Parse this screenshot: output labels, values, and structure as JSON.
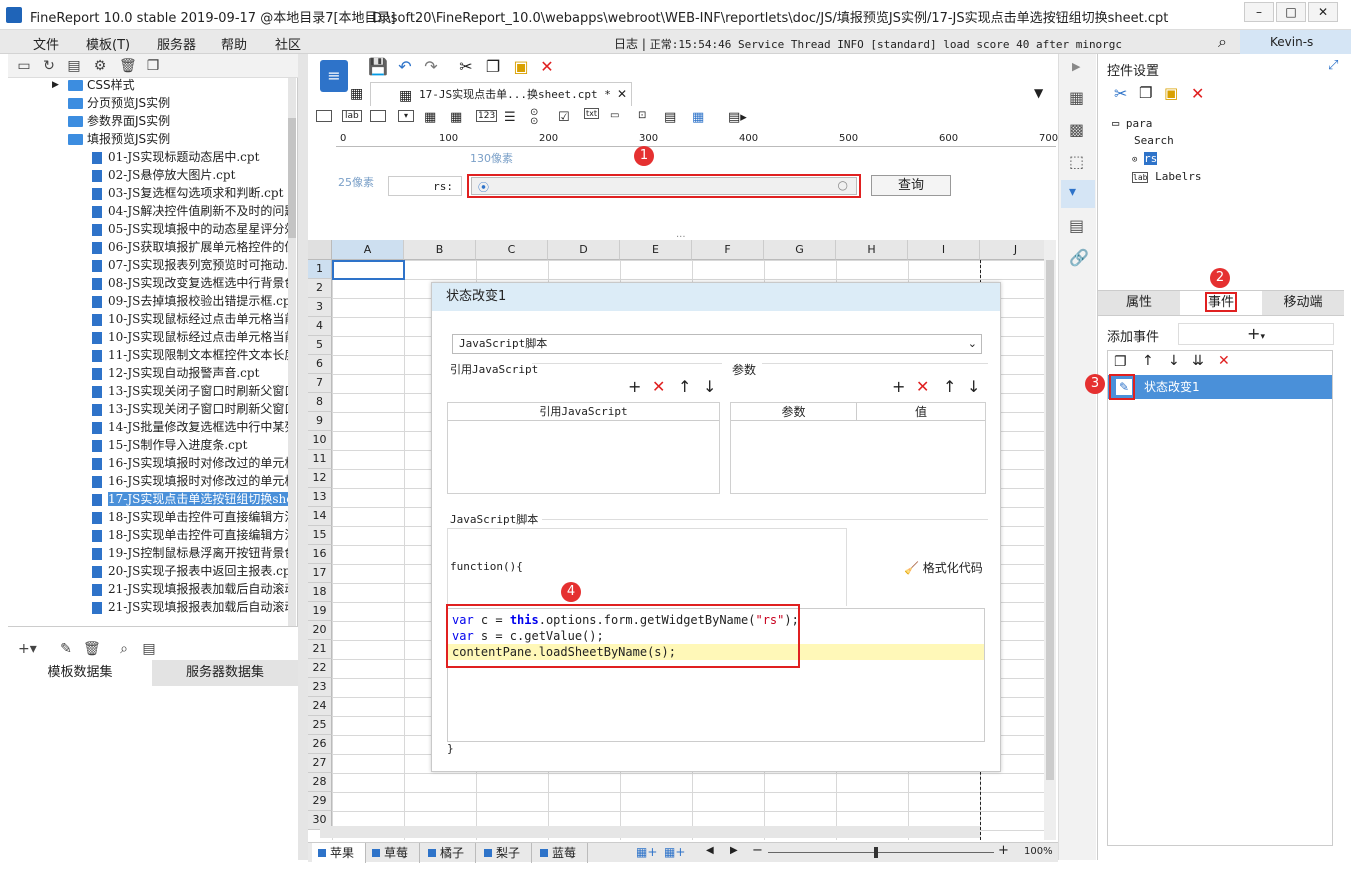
{
  "window": {
    "title": "FineReport 10.0 stable 2019-09-17 @本地目录7[本地目录]",
    "path": "D:\\soft20\\FineReport_10.0\\webapps\\webroot\\WEB-INF\\reportlets\\doc/JS/填报预览JS实例/17-JS实现点击单选按钮组切换sheet.cpt"
  },
  "menu": [
    "文件",
    "模板(T)",
    "服务器",
    "帮助",
    "社区"
  ],
  "log": {
    "label": "日志",
    "sep": "|",
    "text": "正常:15:54:46 Service Thread INFO [standard] load score 40 after minorgc"
  },
  "user": "Kevin-s",
  "tree": {
    "folders": [
      "CSS样式",
      "分页预览JS实例",
      "参数界面JS实例",
      "填报预览JS实例"
    ],
    "files": [
      "01-JS实现标题动态居中.cpt",
      "02-JS悬停放大图片.cpt",
      "03-JS复选框勾选项求和判断.cpt",
      "04-JS解决控件值刷新不及时的问题",
      "05-JS实现填报中的动态星星评分效",
      "06-JS获取填报扩展单元格控件的值",
      "07-JS实现报表列宽预览时可拖动.",
      "08-JS实现改变复选框选中行背景色",
      "09-JS去掉填报校验出错提示框.cp",
      "10-JS实现鼠标经过点击单元格当前",
      "10-JS实现鼠标经过点击单元格当前",
      "11-JS实现限制文本框控件文本长度",
      "12-JS实现自动报警声音.cpt",
      "13-JS实现关闭子窗口时刷新父窗口",
      "13-JS实现关闭子窗口时刷新父窗口",
      "14-JS批量修改复选框选中行中某列",
      "15-JS制作导入进度条.cpt",
      "16-JS实现填报时对修改过的单元格",
      "16-JS实现填报时对修改过的单元格",
      "17-JS实现点击单选按钮组切换she",
      "18-JS实现单击控件可直接编辑方法",
      "18-JS实现单击控件可直接编辑方法",
      "19-JS控制鼠标悬浮离开按钮背景色",
      "20-JS实现子报表中返回主报表.cp",
      "21-JS实现填报报表加载后自动滚动",
      "21-JS实现填报报表加载后自动滚动"
    ]
  },
  "datasets": {
    "tab1": "模板数据集",
    "tab2": "服务器数据集"
  },
  "doc_tab": "17-JS实现点击单...换sheet.cpt *",
  "ruler": [
    "0",
    "100",
    "200",
    "300",
    "400",
    "500",
    "600",
    "700"
  ],
  "params": {
    "width_label": "130像素",
    "height_label": "25像素",
    "rs_label": "rs:",
    "query_btn": "查询"
  },
  "columns": [
    "A",
    "B",
    "C",
    "D",
    "E",
    "F",
    "G",
    "H",
    "I",
    "J"
  ],
  "rows": [
    "1",
    "2",
    "3",
    "4",
    "5",
    "6",
    "7",
    "8",
    "9",
    "10",
    "11",
    "12",
    "13",
    "14",
    "15",
    "16",
    "17",
    "18",
    "19",
    "20",
    "21",
    "22",
    "23",
    "24",
    "25",
    "26",
    "27",
    "28",
    "29",
    "30"
  ],
  "dialog": {
    "title": "状态改变1",
    "type": "JavaScript脚本",
    "ref_label": "引用JavaScript",
    "param_label": "参数",
    "ref_col": "引用JavaScript",
    "param_col": "参数",
    "value_col": "值",
    "script_label": "JavaScript脚本",
    "func_open": "function(){",
    "format_btn": "格式化代码",
    "close": "}",
    "code": [
      "var c = this.options.form.getWidgetByName(\"rs\");",
      "var s = c.getValue();",
      "contentPane.loadSheetByName(s);"
    ]
  },
  "right": {
    "title": "控件设置",
    "widgets": [
      "para",
      "Search",
      "rs",
      "Labelrs"
    ],
    "tabs": [
      "属性",
      "事件",
      "移动端"
    ],
    "add_event": "添加事件",
    "event": "状态改变1"
  },
  "badges": [
    "1",
    "2",
    "3",
    "4"
  ],
  "sheets": [
    "苹果",
    "草莓",
    "橘子",
    "梨子",
    "蓝莓"
  ],
  "zoom": "100%",
  "colors": {
    "accent": "#4a90d9",
    "highlight": "#e02020",
    "codeline": "#fff8b8",
    "keyword": "#0000ee",
    "string": "#c8001e"
  }
}
